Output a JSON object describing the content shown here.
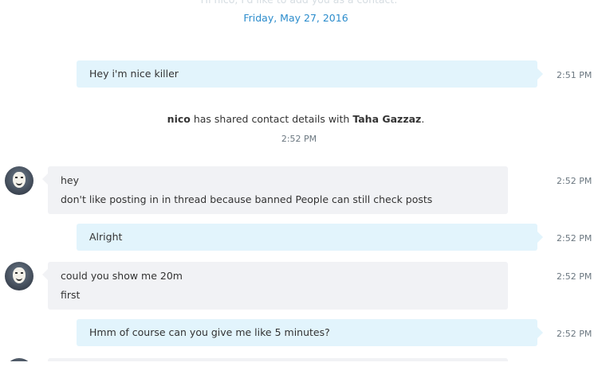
{
  "header": {
    "faded_text": "Hi nico, I'd like to add you as a contact.",
    "date": "Friday, May 27, 2016"
  },
  "messages": [
    {
      "direction": "out",
      "lines": [
        "Hey i'm nice killer"
      ],
      "time": "2:51 PM"
    },
    {
      "direction": "in",
      "lines": [
        "hey",
        "don't like posting in in thread because banned People can still check posts"
      ],
      "time": "2:52 PM"
    },
    {
      "direction": "out",
      "lines": [
        "Alright"
      ],
      "time": "2:52 PM"
    },
    {
      "direction": "in",
      "lines": [
        "could you show me 20m",
        "first"
      ],
      "time": "2:52 PM"
    },
    {
      "direction": "out",
      "lines": [
        "Hmm of course can you give me like 5 minutes?"
      ],
      "time": "2:52 PM"
    }
  ],
  "system_message": {
    "sender": "nico",
    "text": " has shared contact details with ",
    "contact": "Taha Gazzaz",
    "suffix": ".",
    "time": "2:52 PM"
  },
  "colors": {
    "outgoing_bubble": "#e2f4fc",
    "incoming_bubble": "#f1f2f5",
    "date_accent": "#2b8ccc",
    "timestamp": "#6b7780"
  },
  "icons": {
    "avatar": "anonymous-mask-avatar-icon"
  }
}
